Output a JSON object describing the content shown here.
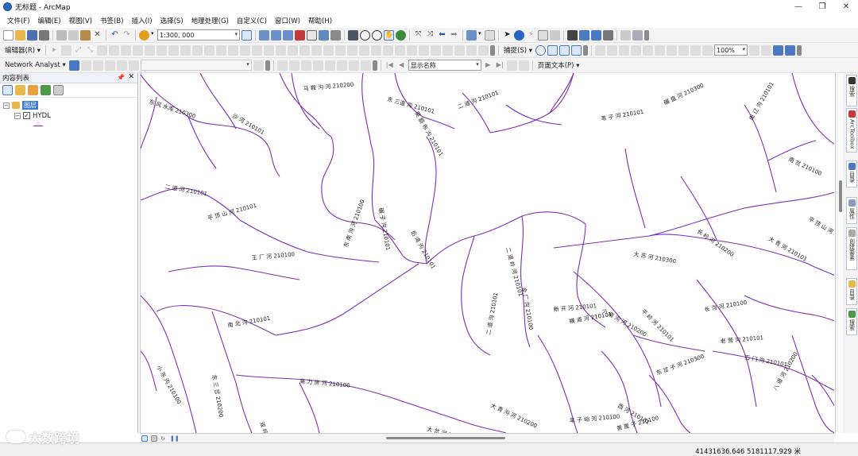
{
  "window": {
    "title": "无标题 - ArcMap",
    "controls": [
      "—",
      "❐",
      "✕"
    ]
  },
  "menu": [
    "文件(F)",
    "编辑(E)",
    "视图(V)",
    "书签(B)",
    "插入(I)",
    "选择(S)",
    "地理处理(G)",
    "自定义(C)",
    "窗口(W)",
    "帮助(H)"
  ],
  "toolbar1": {
    "scale": "1:300, 000"
  },
  "toolbar2": {
    "editor_label": "编辑器(R) ▾",
    "snapping_label": "捕捉(S) ▾",
    "zoom_value": "100%"
  },
  "toolbar3": {
    "network_analyst_label": "Network Analyst ▾",
    "display_name": "显示名称",
    "page_text_label": "页面文本(P) ▾"
  },
  "toc": {
    "title": "内容列表",
    "pin": "📌",
    "close": "✕",
    "root_layer": "图层",
    "layer_name": "HYDL",
    "layer_checked": true
  },
  "right_panel_tabs": [
    "搜索",
    "ArcToolbox",
    "目录",
    "属性",
    "创建要素",
    "目录",
    "搜索"
  ],
  "status": {
    "coordinates": "41431636.646  5181117.929 米"
  },
  "watermark": "大数跨境",
  "map": {
    "line_color": "#7d2fb4",
    "labels": [
      "东 风 水库 210300",
      "马 鞍 沟 河 210200",
      "东 三道 沟 210101",
      "二 道 沟 210101",
      "沙 河 210101",
      "英 额 布 沟 210101",
      "苇 子 河 210101",
      "碾 盘 河 210300",
      "南 辽 沟 210101",
      "南 岔 210100",
      "二 道 河 210101",
      "平 顶 山 河 210101",
      "王 厂 河 210100",
      "东 南 沟 河 210100",
      "碾 子 沟 210101",
      "后 湾 沟 210101",
      "二 道 岭 河 210101",
      "金 厂 沟 210100",
      "新 开 河 210101",
      "小 南 沟 河 210200",
      "横 道 河 210101",
      "大 苏 河 210300",
      "长 岭 河 210200",
      "大 青 河 210101",
      "平 顶 山 河 210200",
      "长 沟 河 210100",
      "老 营 沟 210101",
      "石 门 沟 210101",
      "八 道 河 210200",
      "东 岔 子 河 210300",
      "西 河 210101",
      "黄 崖 子 210100",
      "大 岔 河 210101",
      "苇 子 峪 河 210100",
      "大 青 沟 河 210200",
      "高 力 房 河 210100",
      "双 岭 河 210101",
      "东 三 岔 210200",
      "小 东 沟 210100",
      "南 北 沟 210101",
      "二 道 沟 210101",
      "平 岭 河 210101"
    ]
  }
}
